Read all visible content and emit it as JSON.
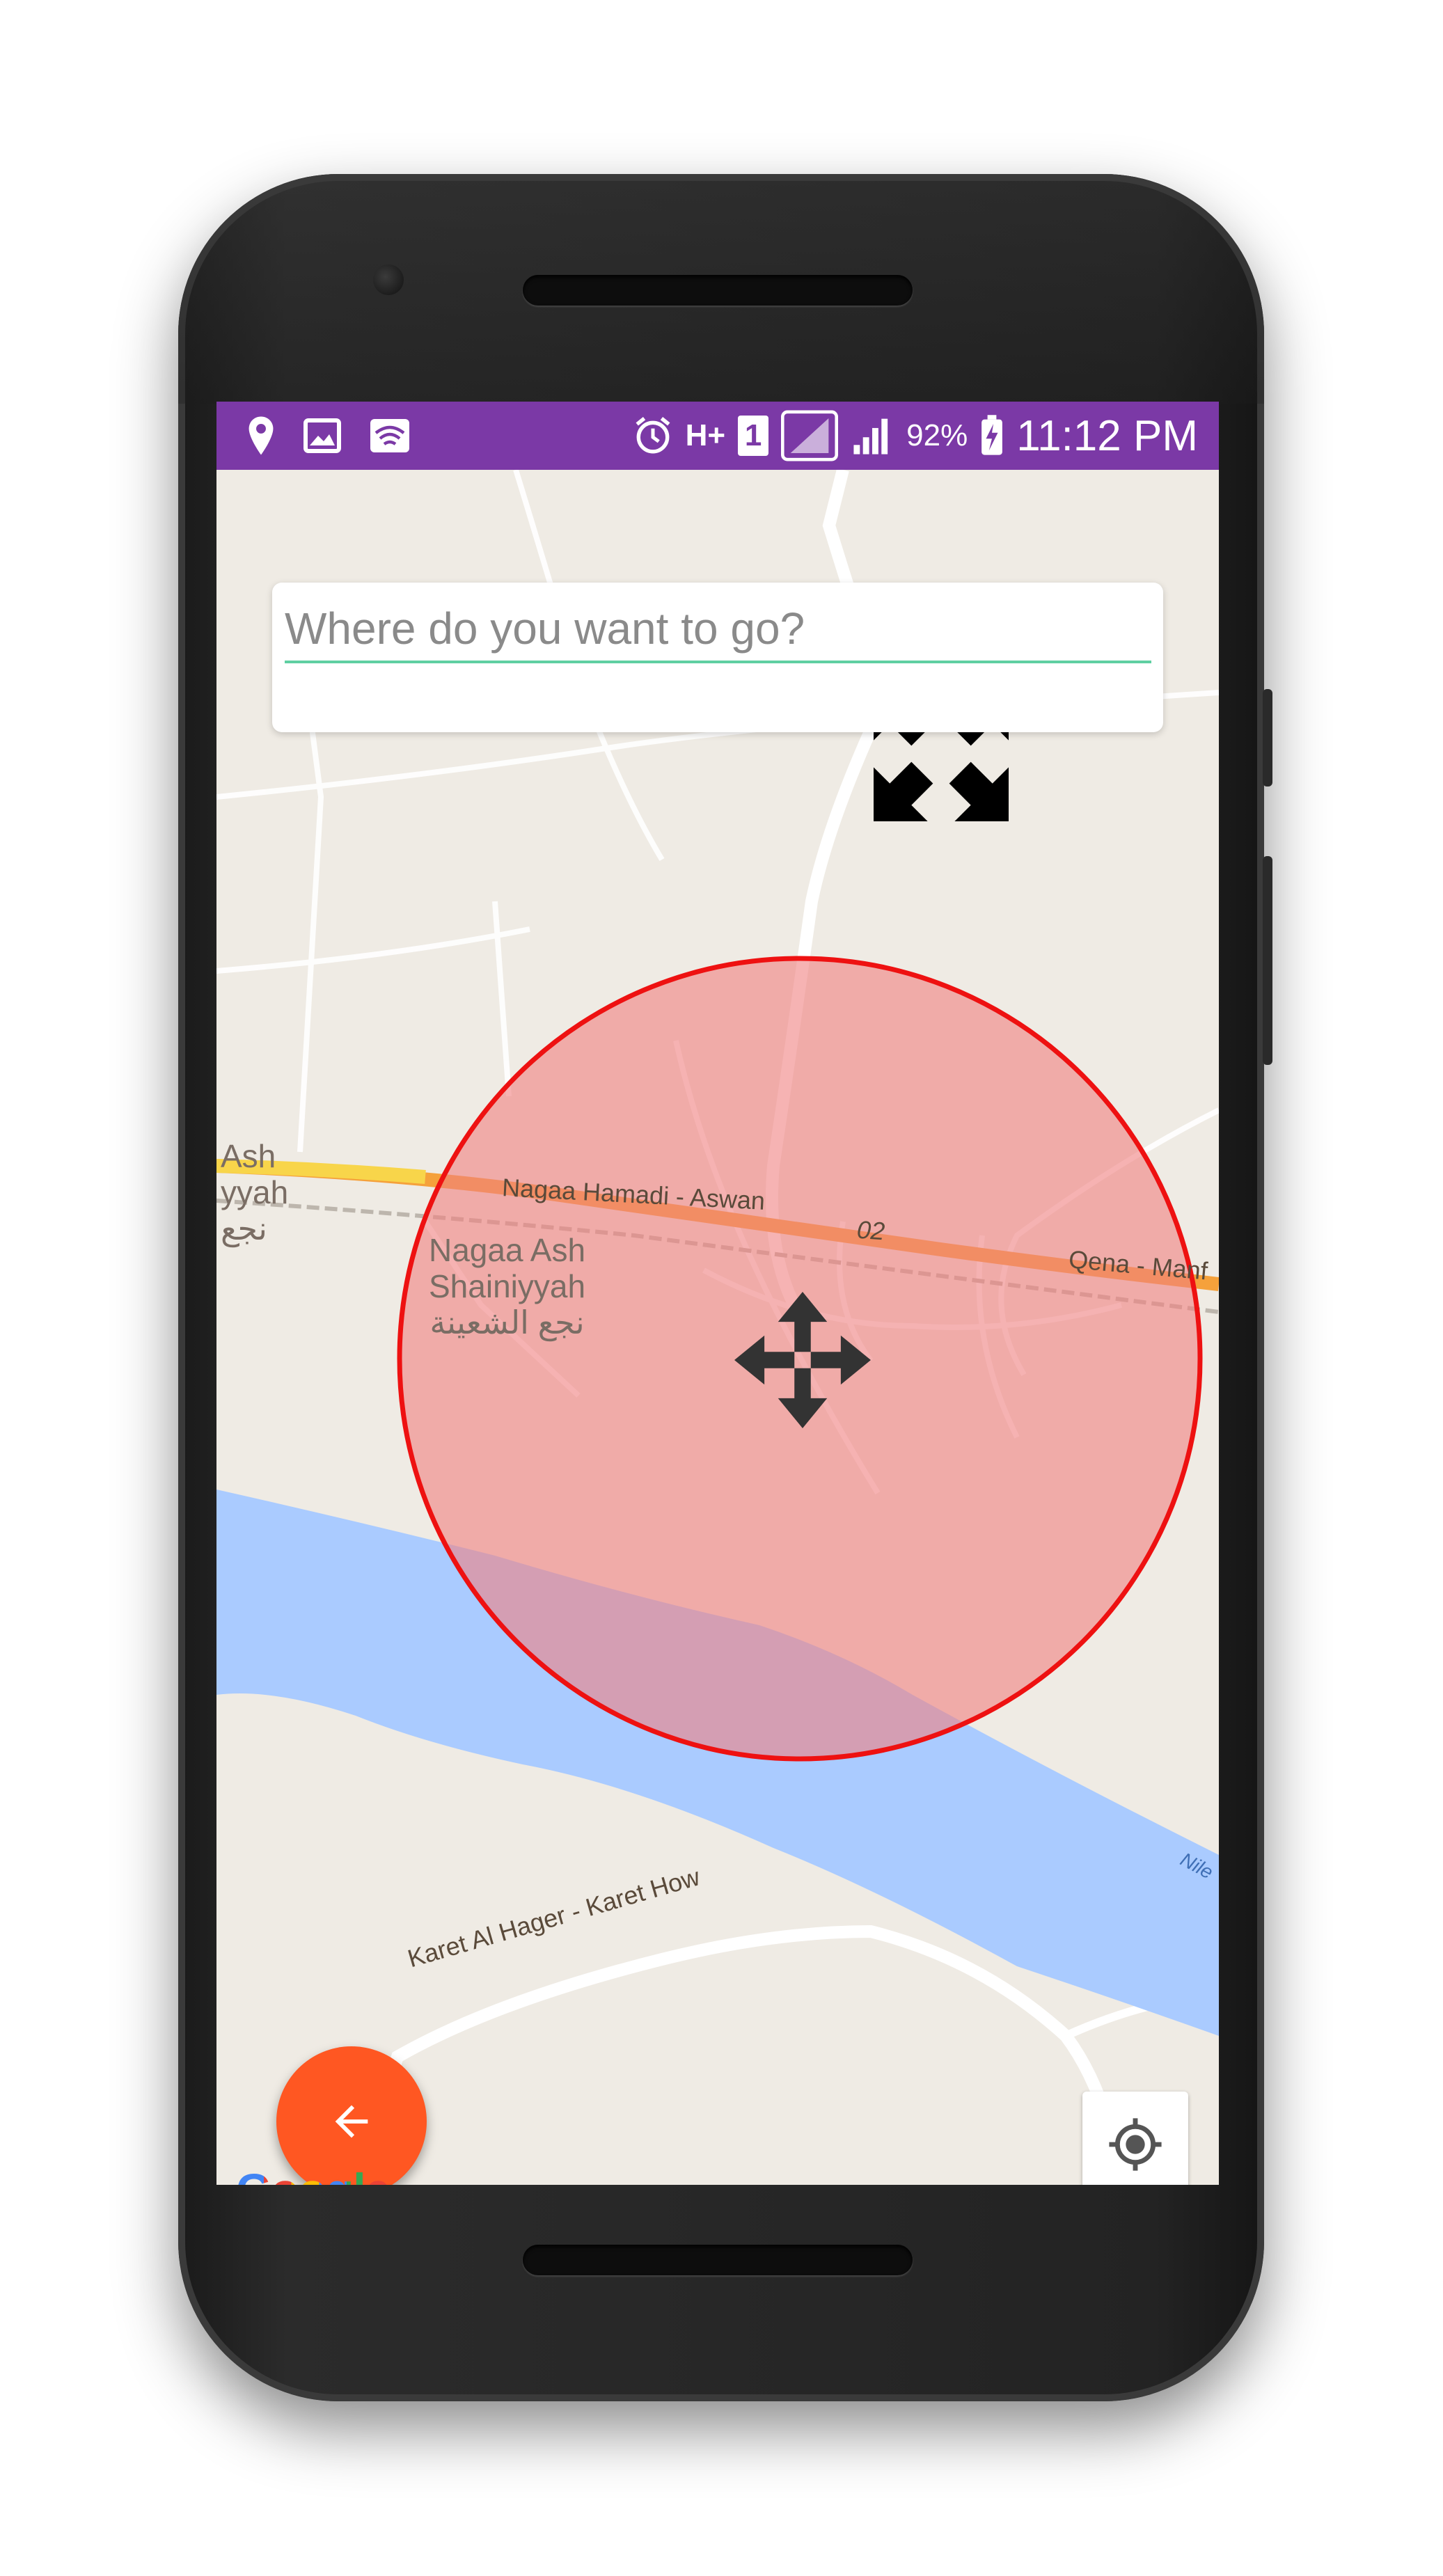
{
  "status_bar": {
    "battery": "92%",
    "time": "11:12 PM",
    "network": "H+",
    "sim": "1",
    "icons": [
      "location-pin-icon",
      "gallery-icon",
      "wifi-icon",
      "alarm-icon",
      "network-type-icon",
      "sim-icon",
      "signal-icon",
      "signal-icon",
      "battery-charging-icon"
    ]
  },
  "search": {
    "placeholder": "Where do you want to go?",
    "value": ""
  },
  "map": {
    "roads": {
      "highway": "Nagaa Hamadi - Aswan",
      "route_number": "02",
      "highway_east": "Qena - Manf",
      "south_road": "Karet Al Hager - Karet How"
    },
    "town": {
      "left_fragment_1": "Ash",
      "left_fragment_2": "yyah",
      "left_fragment_arabic": "نجع",
      "name_line1": "Nagaa Ash",
      "name_line2": "Shainiyyah",
      "name_arabic": "نجع الشعينة"
    },
    "river": "Nile",
    "attribution": "Google",
    "colors": {
      "land": "#efebe4",
      "water": "#aacbff",
      "highway": "#f5a13b",
      "circle_fill": "#f08080",
      "circle_stroke": "#ee1111",
      "fab": "#ff5722",
      "status_bar": "#7b39a6"
    }
  },
  "controls": {
    "resize_icon": "resize-expand-icon",
    "move_icon": "move-arrows-icon",
    "back_icon": "arrow-back-icon",
    "my_location_icon": "my-location-icon"
  }
}
